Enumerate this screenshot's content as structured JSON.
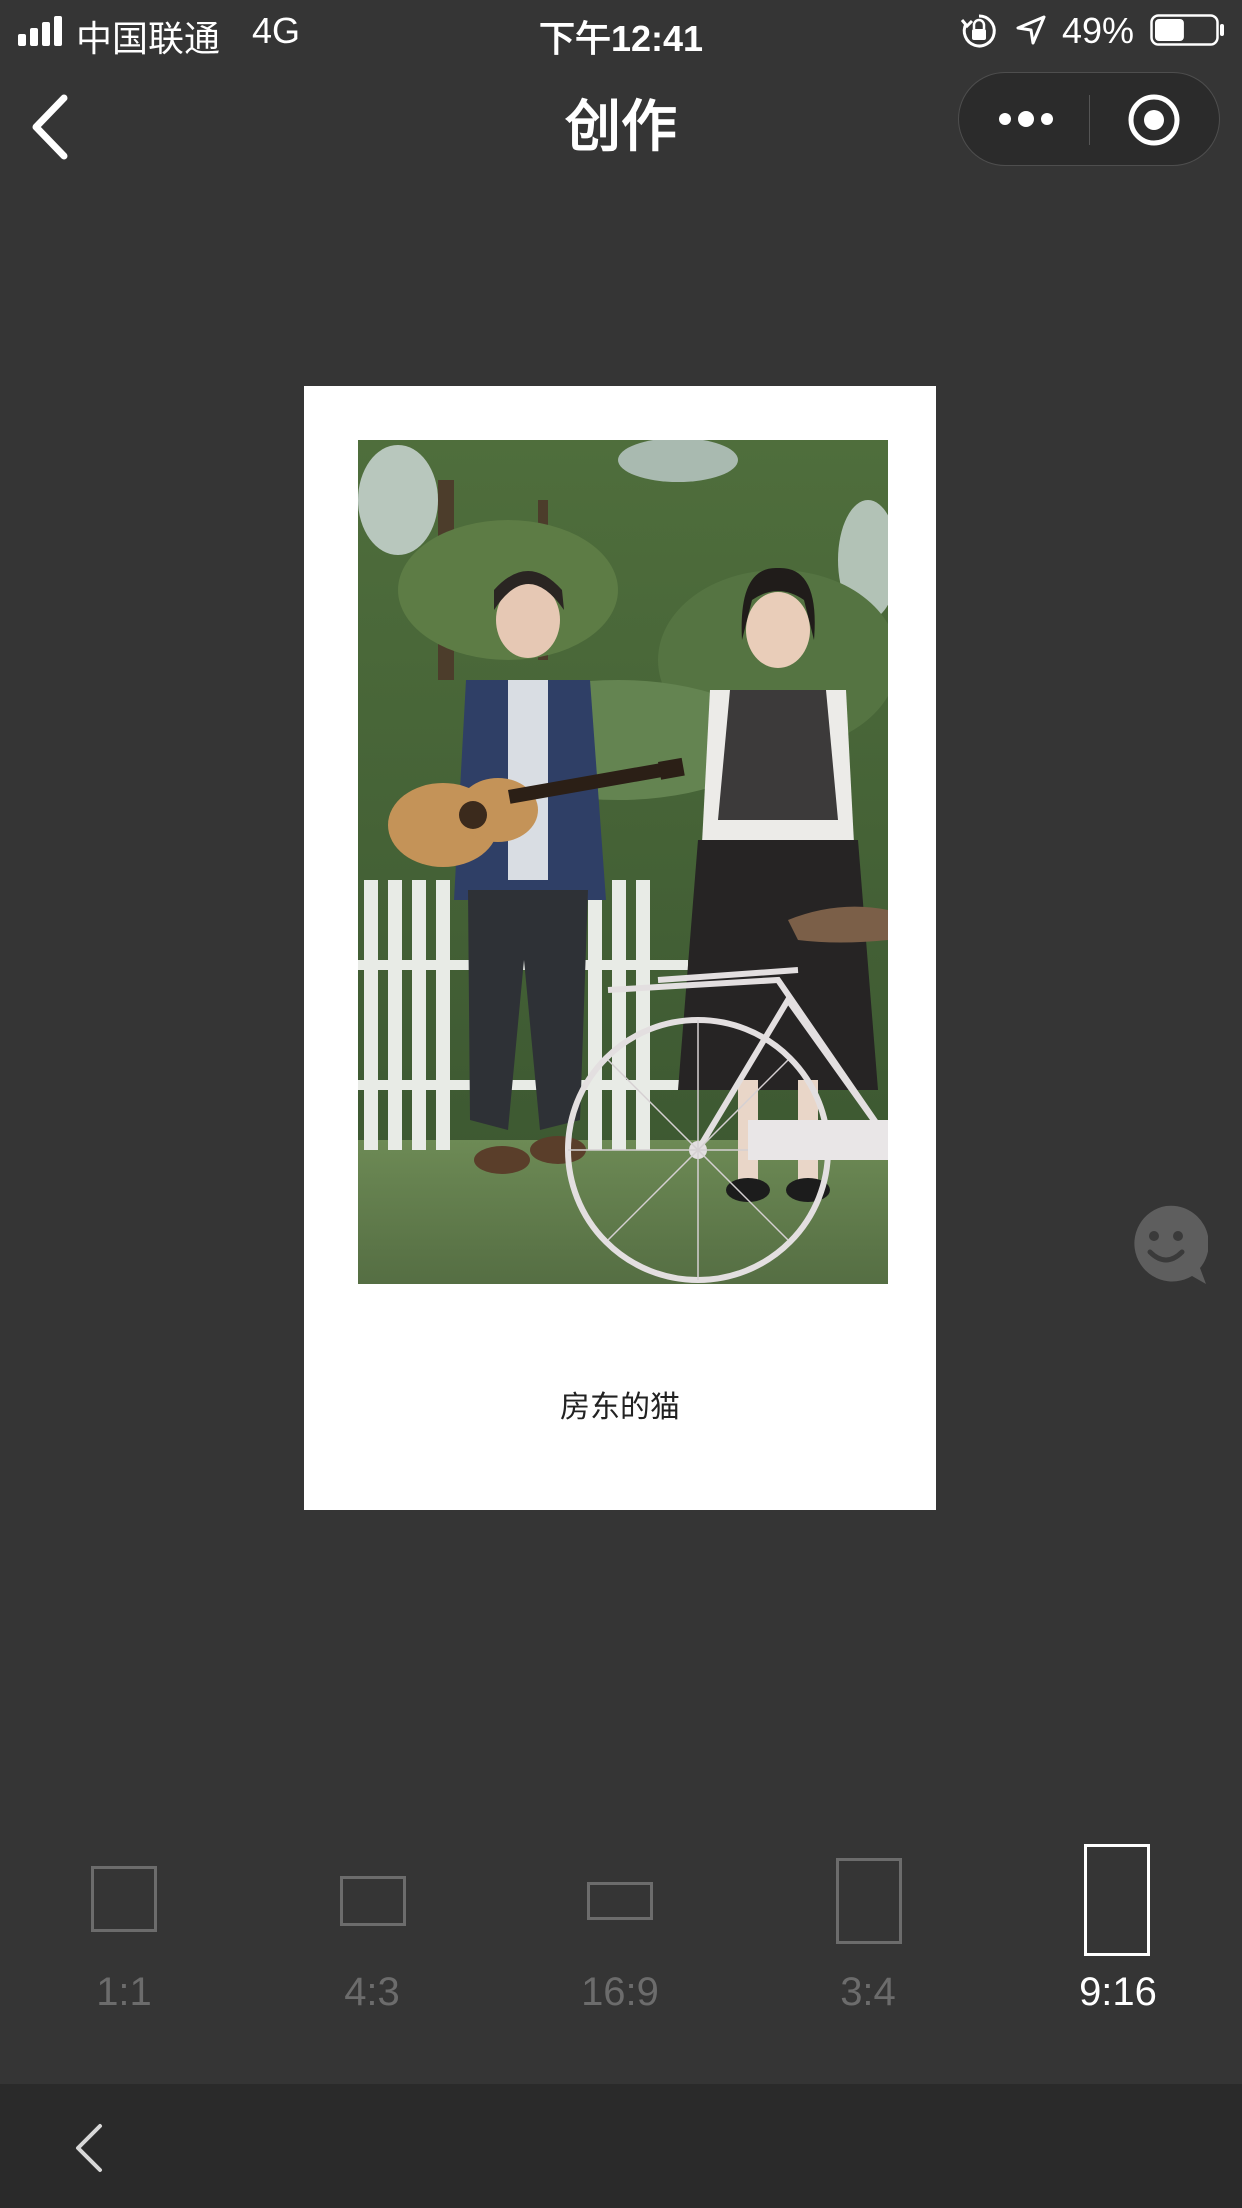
{
  "status_bar": {
    "carrier": "中国联通",
    "network": "4G",
    "time": "下午12:41",
    "battery": "49%",
    "battery_level": 0.49,
    "icons": [
      "signal-icon",
      "orientation-lock-icon",
      "location-icon",
      "battery-icon"
    ]
  },
  "nav": {
    "title": "创作",
    "icons": [
      "back-icon",
      "more-icon",
      "target-icon"
    ]
  },
  "card": {
    "caption": "房东的猫",
    "photo": "photo-of-two-people-with-guitar-and-bicycle"
  },
  "floating": {
    "icon": "chat-smile-icon"
  },
  "ratios": {
    "selected": "9:16",
    "items": [
      {
        "label": "1:1"
      },
      {
        "label": "4:3"
      },
      {
        "label": "16:9"
      },
      {
        "label": "3:4"
      },
      {
        "label": "9:16"
      }
    ]
  },
  "bottom_bar": {
    "icon": "back-chevron-icon"
  },
  "colors": {
    "background": "#353535",
    "muted": "#6c6c6c",
    "selected": "#ffffff"
  }
}
